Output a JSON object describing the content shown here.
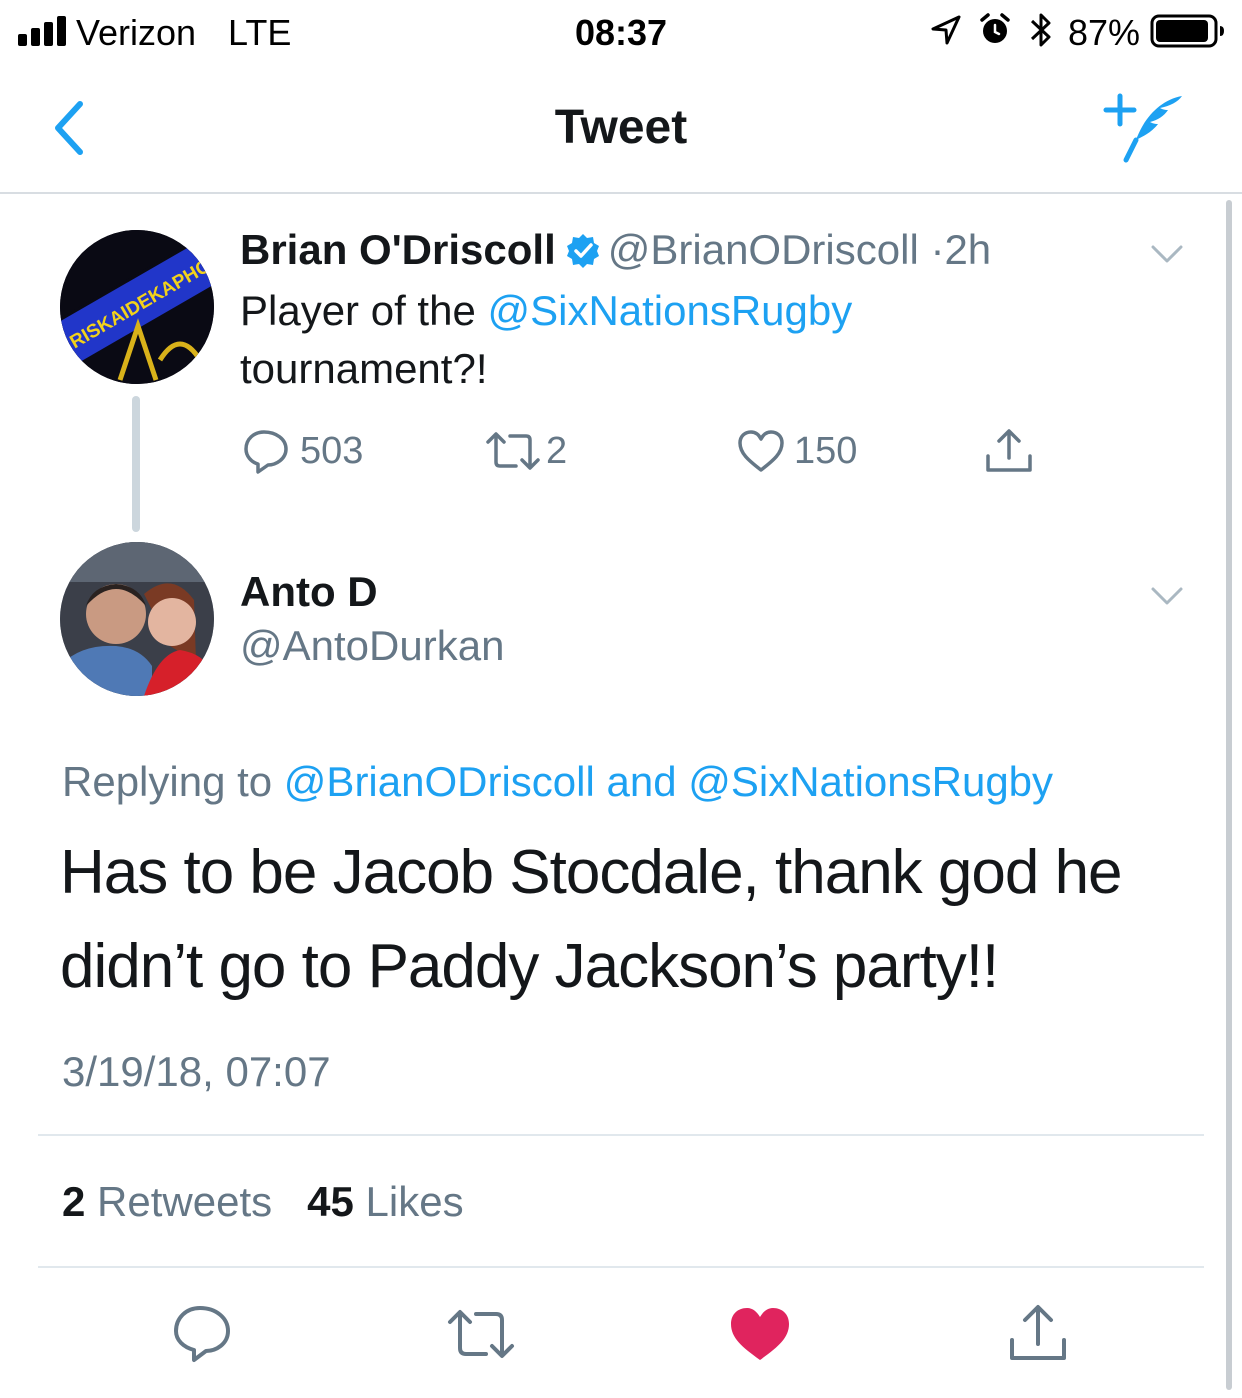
{
  "status_bar": {
    "carrier": "Verizon",
    "network": "LTE",
    "time": "08:37",
    "battery_percent": "87%",
    "icons": [
      "signal-bars-icon",
      "location-arrow-icon",
      "alarm-clock-icon",
      "bluetooth-icon",
      "battery-icon"
    ]
  },
  "nav": {
    "title": "Tweet",
    "back_icon": "chevron-left-icon",
    "compose_icon": "compose-tweet-icon"
  },
  "parent_tweet": {
    "author_name": "Brian O'Driscoll",
    "verified": true,
    "handle": "@BrianODriscoll",
    "separator": "·",
    "age": "2h",
    "text_before": "Player of the ",
    "mention": "@SixNationsRugby",
    "text_after": "tournament?!",
    "avatar_text": "RISKAIDEKAPHOBI",
    "actions": {
      "replies": "503",
      "retweets": "2",
      "likes": "150"
    }
  },
  "reply_tweet": {
    "author_name": "Anto D",
    "handle": "@AntoDurkan",
    "replying_prefix": "Replying to",
    "replying_user1": "@BrianODriscoll",
    "replying_and": "and",
    "replying_user2": "@SixNationsRugby",
    "body": "Has to be Jacob Stocdale, thank god he didn’t go to Paddy Jackson’s party!!",
    "timestamp": "3/19/18, 07:07",
    "retweets_count": "2",
    "retweets_label": "Retweets",
    "likes_count": "45",
    "likes_label": "Likes",
    "liked": true
  },
  "colors": {
    "accent": "#1da1f2",
    "muted": "#657786",
    "text": "#14171a",
    "like": "#e0245e",
    "divider": "#e1e8ed"
  }
}
